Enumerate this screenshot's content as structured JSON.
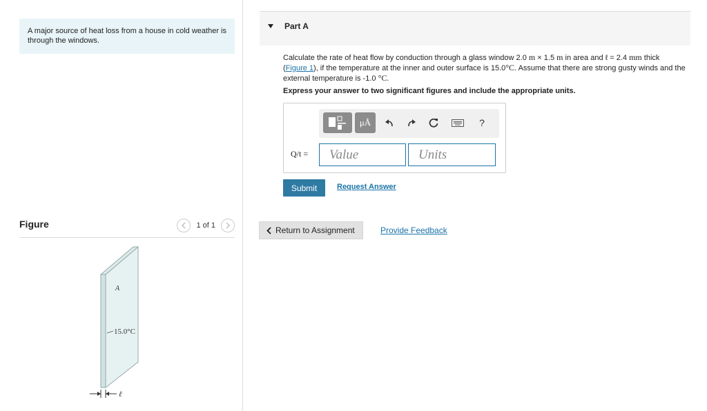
{
  "intro": {
    "text": "A major source of heat loss from a house in cold weather is through the windows."
  },
  "figure": {
    "title": "Figure",
    "count": "1 of 1",
    "prev_icon": "chevron-left-icon",
    "next_icon": "chevron-right-icon",
    "label_a": "A",
    "label_temp": "15.0°C",
    "label_thickness": "ℓ"
  },
  "part": {
    "title": "Part A",
    "question_1": "Calculate the rate of heat flow by conduction through a glass window 2.0 ",
    "unit_m1": "m",
    "times": " × 1.5 ",
    "unit_m2": "m",
    "question_2": " in area and ℓ = 2.4 ",
    "unit_mm": "mm",
    "question_3": " thick",
    "figure_link": "Figure 1",
    "question_4": "), if the temperature at the inner and outer surface is 15.0",
    "deg_c": "°C",
    "question_5": ". Assume that there are strong gusty winds and the external temperature is -1.0 ",
    "deg_c2": "°C",
    "question_6": ".",
    "instruction": "Express your answer to two significant figures and include the appropriate units."
  },
  "answer": {
    "label": "Q/t =",
    "value_placeholder": "Value",
    "units_placeholder": "Units",
    "toolbar": {
      "templates_icon": "templates-icon",
      "units_symbol": "μÅ",
      "undo_icon": "undo-icon",
      "redo_icon": "redo-icon",
      "reset_icon": "reset-icon",
      "keyboard_icon": "keyboard-icon",
      "help_symbol": "?"
    }
  },
  "actions": {
    "submit": "Submit",
    "request_answer": "Request Answer",
    "return": "Return to Assignment",
    "feedback": "Provide Feedback"
  }
}
